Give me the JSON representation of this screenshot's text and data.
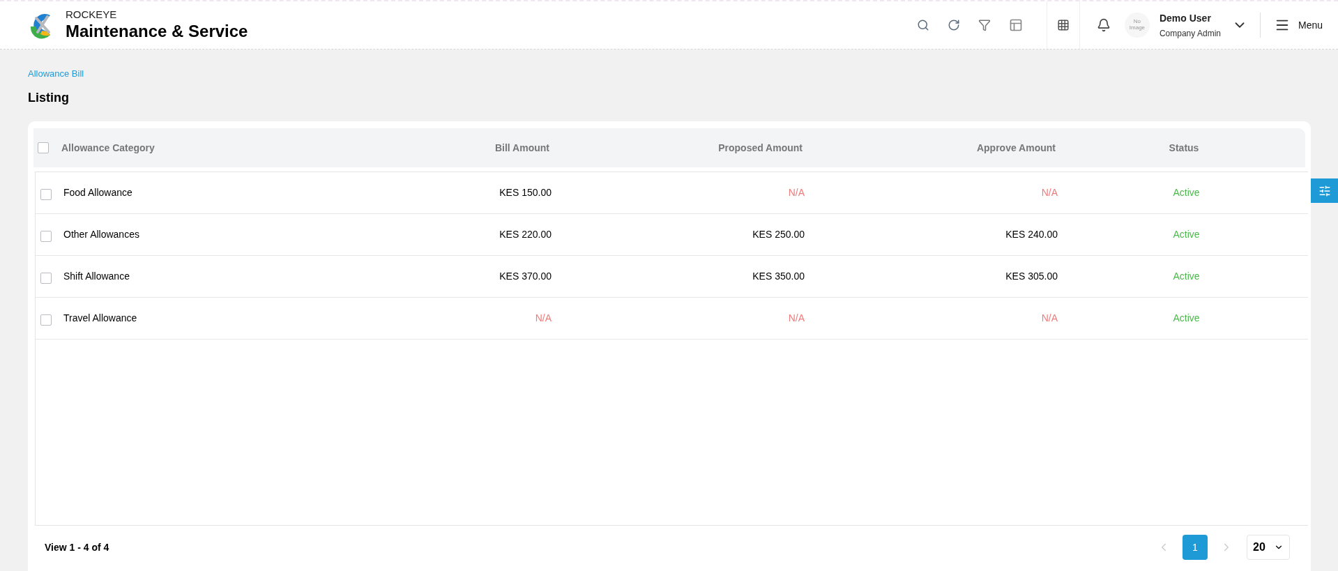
{
  "header": {
    "brand": "ROCKEYE",
    "product": "Maintenance & Service",
    "avatar_text": "No Image",
    "user_name": "Demo User",
    "user_role": "Company Admin",
    "menu_label": "Menu"
  },
  "breadcrumb": "Allowance Bill",
  "page_title": "Listing",
  "table": {
    "select_all": {
      "checked": false
    },
    "columns": [
      "Allowance Category",
      "Bill Amount",
      "Proposed Amount",
      "Approve Amount",
      "Status"
    ],
    "rows": [
      {
        "checked": false,
        "cells": [
          {
            "text": "Food Allowance",
            "kind": "text"
          },
          {
            "text": "KES 150.00",
            "kind": "amount"
          },
          {
            "text": "N/A",
            "kind": "na"
          },
          {
            "text": "N/A",
            "kind": "na"
          },
          {
            "text": "Active",
            "kind": "active"
          }
        ]
      },
      {
        "checked": false,
        "cells": [
          {
            "text": "Other Allowances",
            "kind": "text"
          },
          {
            "text": "KES 220.00",
            "kind": "amount"
          },
          {
            "text": "KES 250.00",
            "kind": "amount"
          },
          {
            "text": "KES 240.00",
            "kind": "amount"
          },
          {
            "text": "Active",
            "kind": "active"
          }
        ]
      },
      {
        "checked": false,
        "cells": [
          {
            "text": "Shift Allowance",
            "kind": "text"
          },
          {
            "text": "KES 370.00",
            "kind": "amount"
          },
          {
            "text": "KES 350.00",
            "kind": "amount"
          },
          {
            "text": "KES 305.00",
            "kind": "amount"
          },
          {
            "text": "Active",
            "kind": "active"
          }
        ]
      },
      {
        "checked": false,
        "cells": [
          {
            "text": "Travel Allowance",
            "kind": "text"
          },
          {
            "text": "N/A",
            "kind": "na"
          },
          {
            "text": "N/A",
            "kind": "na"
          },
          {
            "text": "N/A",
            "kind": "na"
          },
          {
            "text": "Active",
            "kind": "active"
          }
        ]
      }
    ]
  },
  "footer": {
    "summary": "View 1 - 4 of 4",
    "pages": [
      {
        "label": "1",
        "selected": true
      }
    ],
    "page_size": "20"
  }
}
